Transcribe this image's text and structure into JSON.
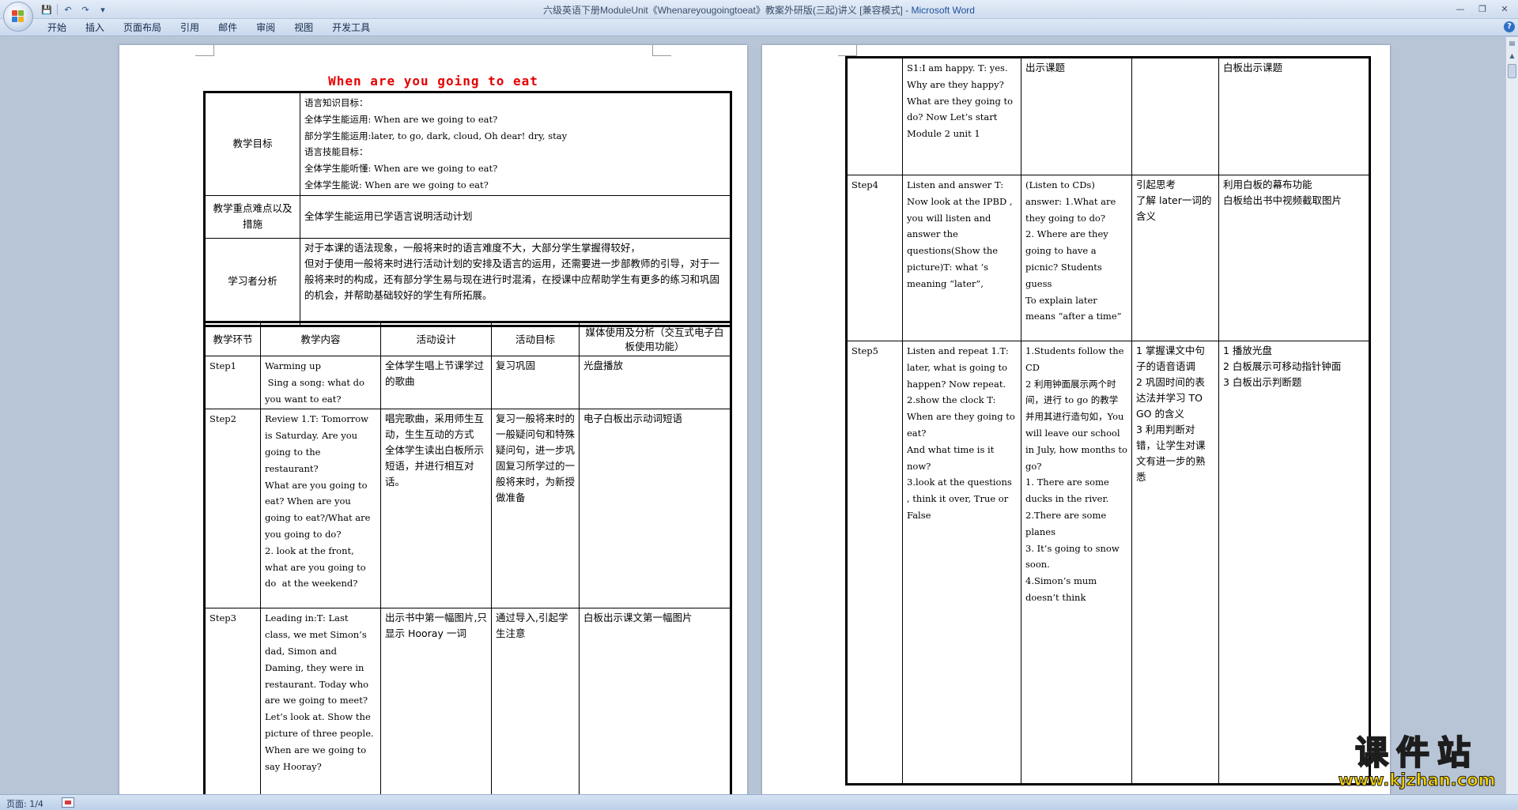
{
  "window": {
    "title": "六级英语下册ModuleUnit《Whenareyougoingtoeat》教案外研版(三起)讲义 [兼容模式] - ",
    "app": "Microsoft Word",
    "controls": [
      "—",
      "❐",
      "✕"
    ]
  },
  "qat": {
    "save": "💾",
    "undo": "↶",
    "redo": "↷",
    "more": "▾"
  },
  "tabs": [
    "开始",
    "插入",
    "页面布局",
    "引用",
    "邮件",
    "审阅",
    "视图",
    "开发工具"
  ],
  "help": "?",
  "status": {
    "page": "页面: 1/4"
  },
  "watermark": {
    "cn": "课件站",
    "url": "www.kjzhan.com"
  },
  "page1": {
    "title": "When are you going to eat",
    "info_rows": [
      {
        "label": "教学目标",
        "lines": [
          "语言知识目标：",
          "全体学生能运用: When are we going to eat?",
          "部分学生能运用:later, to go, dark, cloud, Oh dear! dry, stay",
          "语言技能目标：",
          "全体学生能听懂: When are we going to eat?",
          "全体学生能说: When are we going to eat?"
        ]
      },
      {
        "label": "教学重点难点以及措施",
        "lines": [
          "全体学生能运用已学语言说明活动计划"
        ]
      },
      {
        "label": "学习者分析",
        "lines": [
          "对于本课的语法现象，一般将来时的语言难度不大，大部分学生掌握得较好，",
          "但对于使用一般将来时进行活动计划的安排及语言的运用，还需要进一步部教师的引导，对于一般将来时的构成，还有部分学生易与现在进行时混淆，在授课中应帮助学生有更多的练习和巩固的机会，并帮助基础较好的学生有所拓展。"
        ]
      }
    ],
    "headers": [
      "教学环节",
      "教学内容",
      "活动设计",
      "活动目标",
      "媒体使用及分析（交互式电子白板使用功能）"
    ],
    "steps": [
      {
        "step": "Step1",
        "content": [
          "Warming up",
          " Sing a song: what do you want to eat?"
        ],
        "design": [
          "全体学生唱上节课学过的歌曲"
        ],
        "goal": [
          "复习巩固"
        ],
        "media": [
          "光盘播放"
        ]
      },
      {
        "step": "Step2",
        "content": [
          "Review 1.T: Tomorrow is Saturday. Are you going to the restaurant?",
          "What are you going to eat? When are you going to eat?/What are you going to do?",
          "2. look at the front, what are you going to do  at the weekend?"
        ],
        "design": [
          "唱完歌曲，采用师生互动，生生互动的方式",
          "全体学生读出白板所示短语，并进行相互对话。"
        ],
        "goal": [
          "复习一般将来时的一般疑问句和特殊疑问句，进一步巩固复习所学过的一般将来时，为新授做准备"
        ],
        "media": [
          "电子白板出示动词短语"
        ]
      },
      {
        "step": "Step3",
        "content": [
          "Leading in:T: Last class, we met Simon’s dad, Simon and Daming, they were in restaurant. Today who are we going to meet?",
          "Let’s look at. Show the picture of three people. When are we going to say Hooray?"
        ],
        "design": [
          "出示书中第一幅图片,只显示 Hooray 一词"
        ],
        "goal": [
          "通过导入,引起学生注意"
        ],
        "media": [
          "白板出示课文第一幅图片"
        ]
      }
    ]
  },
  "page2": {
    "rows": [
      {
        "step": "",
        "content": [
          "S1:I am happy. T: yes. Why are they happy? What are they going to do? Now Let’s start Module 2 unit 1"
        ],
        "design": [
          "",
          "",
          "出示课题"
        ],
        "goal": [
          ""
        ],
        "media": [
          "",
          "",
          "白板出示课题"
        ]
      },
      {
        "step": "Step4",
        "content": [
          "Listen and answer T: Now look at the IPBD , you will listen and answer the questions(Show the picture)T: what ‘s meaning “later”,"
        ],
        "design": [
          "(Listen to CDs) answer: 1.What are they going to do?",
          "2. Where are they going to have a picnic? Students guess",
          "To explain later means “after a time”"
        ],
        "goal": [
          "引起思考",
          "",
          "",
          "",
          "",
          "",
          "",
          "了解 later一词的含义"
        ],
        "media": [
          "利用白板的幕布功能",
          "",
          "",
          "",
          "",
          "",
          "",
          "白板给出书中视频截取图片"
        ]
      },
      {
        "step": "Step5",
        "content": [
          "Listen and repeat 1.T: later, what is going to happen? Now repeat.",
          "",
          "2.show the clock T: When are they going to eat?",
          "And what time is it now?",
          "",
          "",
          "",
          "",
          "3.look at the questions , think it over, True or False"
        ],
        "design": [
          "1.Students follow the CD",
          "",
          "",
          "2 利用钟面展示两个时间，进行 to go 的教学",
          "并用其进行造句如，You will leave our school in July, how months to go?",
          "",
          "",
          "",
          "",
          "1. There are some ducks in the river.",
          "2.There are some planes",
          "3. It’s going to snow soon.",
          "4.Simon’s mum doesn’t think"
        ],
        "goal": [
          "1 掌握课文中句子的语音语调",
          "",
          "",
          "2 巩固时间的表达法并学习 TO GO 的含义",
          "",
          "",
          "",
          "",
          "",
          "",
          "",
          "3 利用判断对错，让学生对课文有进一步的熟悉"
        ],
        "media": [
          "1 播放光盘",
          "",
          "",
          "",
          "2 白板展示可移动指针钟面",
          "",
          "",
          "",
          "",
          "",
          "",
          "",
          "",
          "",
          "3 白板出示判断题"
        ]
      }
    ]
  }
}
